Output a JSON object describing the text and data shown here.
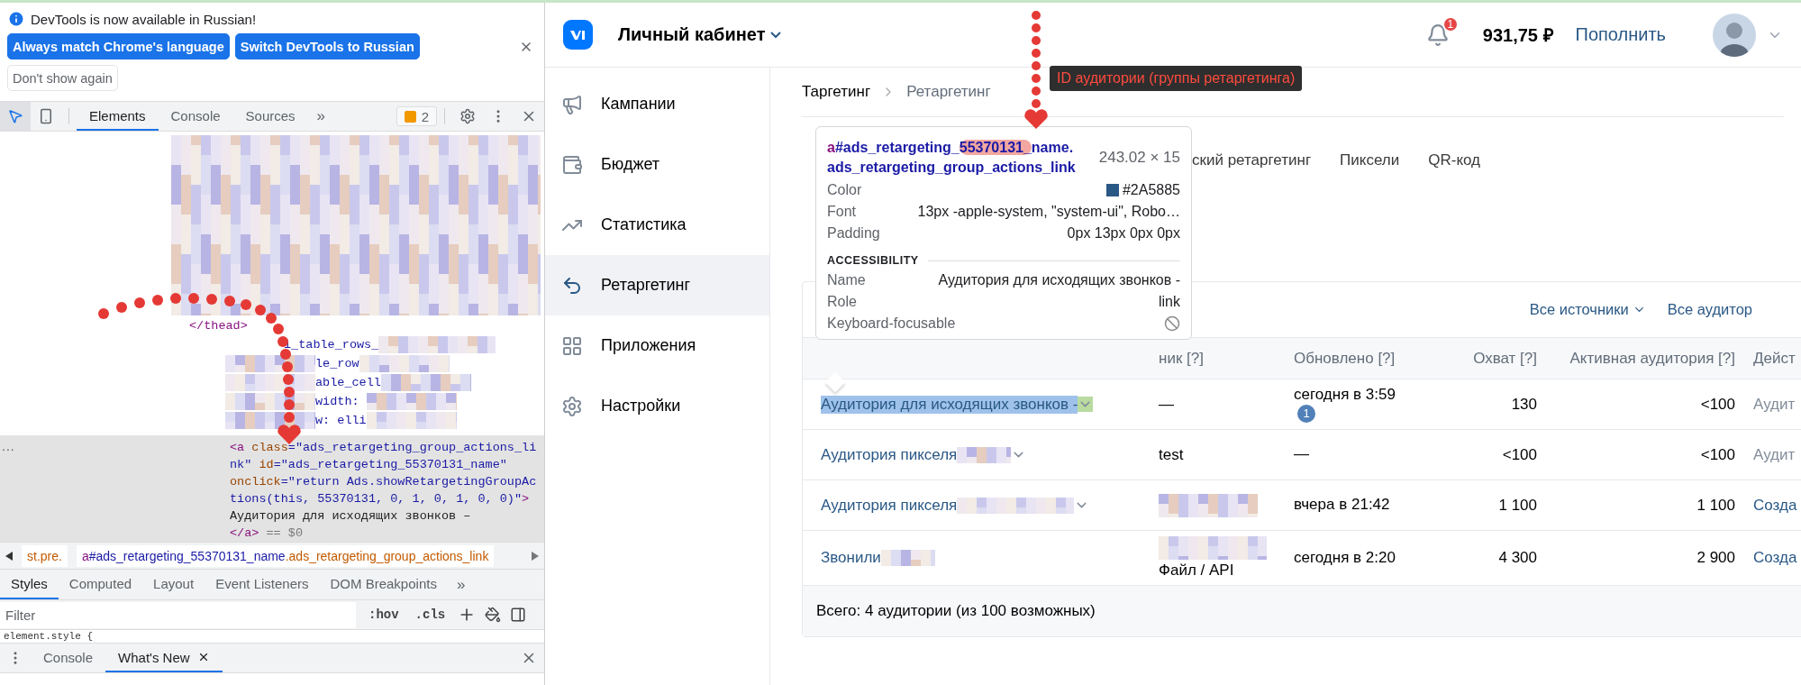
{
  "annotation": {
    "label": "ID аудитории (группы ретаргетинга)"
  },
  "devtools": {
    "infobar": {
      "message": "DevTools is now available in Russian!",
      "buttons": [
        {
          "label": "Always match Chrome's language",
          "kind": "primary"
        },
        {
          "label": "Switch DevTools to Russian",
          "kind": "primary"
        },
        {
          "label": "Don't show again",
          "kind": "secondary"
        }
      ]
    },
    "toolbar": {
      "inspect_active": true,
      "tabs": [
        {
          "label": "Elements",
          "selected": true
        },
        {
          "label": "Console",
          "selected": false
        },
        {
          "label": "Sources",
          "selected": false
        }
      ],
      "more": "»",
      "issues_count": "2"
    },
    "dom_fragments": [
      {
        "text": "</thead>",
        "kind": "tag"
      },
      {
        "text": "i_table_rows_",
        "kind": "value"
      },
      {
        "text": "le_row",
        "kind": "value"
      },
      {
        "text": "able_cell",
        "kind": "value"
      },
      {
        "text": "width: ",
        "kind": "value"
      },
      {
        "text": "w: elli",
        "kind": "value"
      }
    ],
    "selected_node": {
      "gutter": "...",
      "lines": [
        [
          {
            "text": "<a",
            "kind": "tag"
          },
          {
            "text": " class",
            "kind": "attr"
          },
          {
            "text": "=\"ads_retargeting_group_actions_li",
            "kind": "value"
          }
        ],
        [
          {
            "text": "nk\"",
            "kind": "value"
          },
          {
            "text": " id",
            "kind": "attr"
          },
          {
            "text": "=\"ads_retargeting_55370131_name\"",
            "kind": "value"
          }
        ],
        [
          {
            "text": "onclick",
            "kind": "attr"
          },
          {
            "text": "=\"return Ads.showRetargetingGroupAc",
            "kind": "value"
          }
        ],
        [
          {
            "text": "tions(this, 55370131, 0, 1, 0, 1, 0, 0)\"",
            "kind": "value"
          },
          {
            "text": ">",
            "kind": "tag"
          }
        ],
        [
          {
            "text": "Аудитория для исходящих звонков –",
            "kind": "text"
          }
        ],
        [
          {
            "text": "</a>",
            "kind": "tag"
          },
          {
            "text": " == $0",
            "kind": "comment"
          }
        ]
      ]
    },
    "breadcrumbs": [
      [
        {
          "text": "st.pre.",
          "kind": "class"
        }
      ],
      [
        {
          "text": "a",
          "kind": "tag"
        },
        {
          "text": "#ads_retargeting_55370131_name",
          "kind": "id"
        },
        {
          "text": ".ads_retargeting_group_actions_link",
          "kind": "class"
        }
      ]
    ],
    "styles_tabs": [
      {
        "label": "Styles",
        "selected": true
      },
      {
        "label": "Computed",
        "selected": false
      },
      {
        "label": "Layout",
        "selected": false
      },
      {
        "label": "Event Listeners",
        "selected": false
      },
      {
        "label": "DOM Breakpoints",
        "selected": false
      }
    ],
    "styles_more": "»",
    "filter": {
      "placeholder": "Filter",
      "hov": ":hov",
      "cls": ".cls"
    },
    "rule": "element.style {",
    "drawer": {
      "tabs": [
        {
          "label": "Console",
          "selected": false,
          "closable": false
        },
        {
          "label": "What's New",
          "selected": true,
          "closable": true
        }
      ]
    }
  },
  "app": {
    "header": {
      "title": "Личный кабинет",
      "notifications": "1",
      "balance": "931,75 ₽",
      "topup": "Пополнить"
    },
    "sidebar": [
      {
        "label": "Кампании",
        "selected": false
      },
      {
        "label": "Бюджет",
        "selected": false
      },
      {
        "label": "Статистика",
        "selected": false
      },
      {
        "label": "Ретаргетинг",
        "selected": true
      },
      {
        "label": "Приложения",
        "selected": false
      },
      {
        "label": "Настройки",
        "selected": false
      }
    ],
    "breadcrumb": [
      "Таргетинг",
      "Ретаргетинг"
    ],
    "tabs": [
      {
        "label": "ский ретаргетинг",
        "selected": false
      },
      {
        "label": "Пиксели",
        "selected": false
      },
      {
        "label": "QR-код",
        "selected": false
      }
    ],
    "filters": [
      {
        "label": "Все источники",
        "dropdown": true
      },
      {
        "label": "Все аудитор",
        "dropdown": false
      }
    ],
    "columns": [
      "ник [?]",
      "Обновлено [?]",
      "Охват [?]",
      "Активная аудитория [?]",
      "Дейст"
    ],
    "rows": [
      {
        "name": "Аудитория для исходящих звонков -",
        "highlighted": true,
        "redacted": false,
        "dropdown": true,
        "source": "—",
        "source_redacted": false,
        "updated": "сегодня в 3:59",
        "badge": "1",
        "reach": "130",
        "active": "<100",
        "action": "Аудит",
        "muted": true
      },
      {
        "name": "Аудитория пикселя",
        "highlighted": false,
        "redacted": true,
        "dropdown": true,
        "source": "test",
        "source_redacted": false,
        "updated": "—",
        "reach": "<100",
        "active": "<100",
        "action": "Аудит",
        "muted": true
      },
      {
        "name": "Аудитория пикселя",
        "highlighted": false,
        "redacted": true,
        "dropdown": true,
        "source_redacted": true,
        "updated": "вчера в 21:42",
        "reach": "1 100",
        "active": "1 100",
        "action": "Созда",
        "muted": false
      },
      {
        "name": "Звонили",
        "highlighted": false,
        "redacted": true,
        "dropdown": false,
        "source": "Файл / API",
        "source_redacted": true,
        "updated": "сегодня в 2:20",
        "reach": "4 300",
        "active": "2 900",
        "action": "Созда",
        "muted": false
      }
    ],
    "footer": "Всего: 4 аудитории (из 100 возможных)",
    "tooltip": {
      "selector": [
        {
          "text": "a",
          "kind": "tag",
          "highlighted": false
        },
        {
          "text": "#ads_retargeting_",
          "kind": "id",
          "highlighted": false
        },
        {
          "text": "55370131_",
          "kind": "id",
          "highlighted": true
        },
        {
          "text": "name.ads_retargeting_group_actions_link",
          "kind": "id",
          "highlighted": false
        }
      ],
      "size": "243.02 × 15",
      "props": [
        {
          "label": "Color",
          "value": "#2A5885",
          "kind": "color"
        },
        {
          "label": "Font",
          "value": "13px -apple-system, \"system-ui\", Robo…",
          "kind": "text"
        },
        {
          "label": "Padding",
          "value": "0px 13px 0px 0px",
          "kind": "text"
        }
      ],
      "section": "ACCESSIBILITY",
      "a11y": [
        {
          "label": "Name",
          "value": "Аудитория для исходящих звонков -",
          "kind": "text"
        },
        {
          "label": "Role",
          "value": "link",
          "kind": "text"
        },
        {
          "label": "Keyboard-focusable",
          "kind": "blocked"
        }
      ]
    }
  }
}
